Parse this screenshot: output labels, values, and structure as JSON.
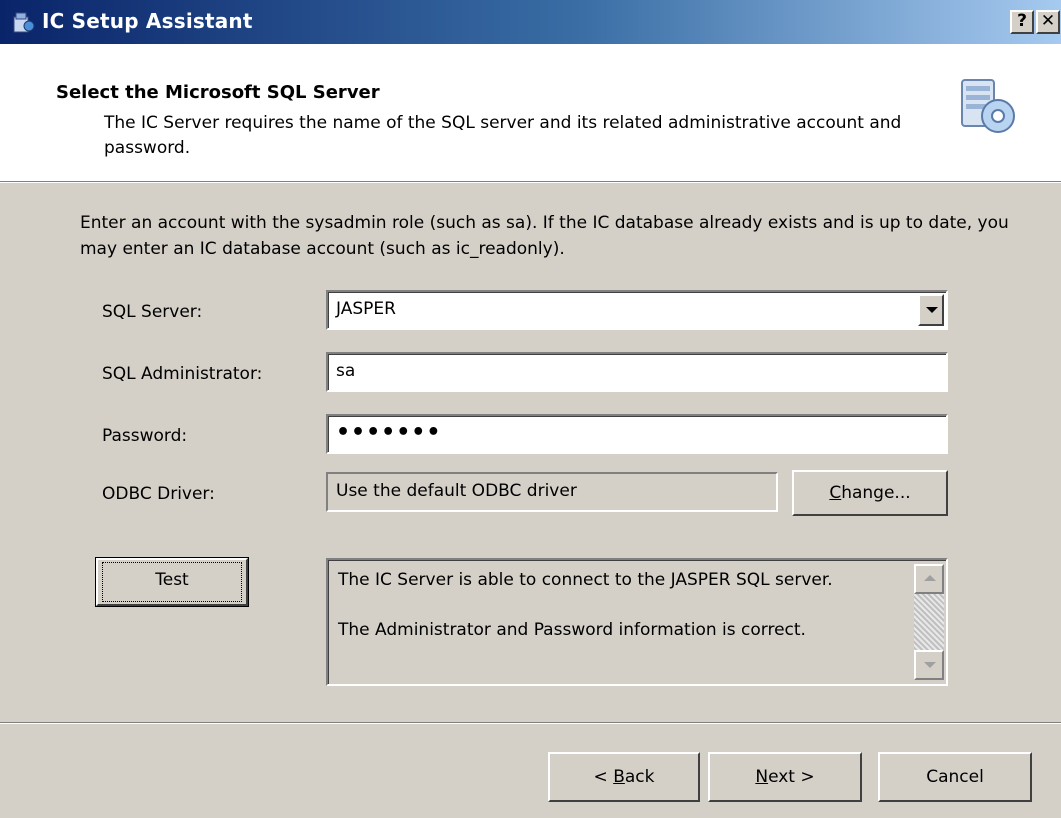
{
  "window": {
    "title": "IC Setup Assistant",
    "help_label": "?",
    "close_label": "✕",
    "icon": "setup-app-icon"
  },
  "header": {
    "title": "Select the Microsoft SQL Server",
    "description": "The IC Server requires the name of the SQL server and its related administrative account and password.",
    "icon": "database-server-icon"
  },
  "instructions": "Enter an account with the sysadmin role (such as sa). If the IC database already exists and is up to date, you may enter an IC database account (such as ic_readonly).",
  "form": {
    "sql_server": {
      "label": "SQL Server:",
      "value": "JASPER"
    },
    "sql_admin": {
      "label": "SQL Administrator:",
      "value": "sa"
    },
    "password": {
      "label": "Password:",
      "value": "•••••••"
    },
    "odbc_driver": {
      "label": "ODBC Driver:",
      "value": "Use the default ODBC driver",
      "change_prefix": "C",
      "change_rest": "hange..."
    }
  },
  "test": {
    "button_label": "Test",
    "result_line1": "The IC Server is able to connect to the JASPER SQL server.",
    "result_line2": "The Administrator and Password information is correct."
  },
  "footer": {
    "back_prefix": "< ",
    "back_key": "B",
    "back_rest": "ack",
    "next_key": "N",
    "next_rest": "ext >",
    "cancel_label": "Cancel"
  },
  "colors": {
    "dialog_bg": "#d4d0c8",
    "title_bar_start": "#0a246a",
    "title_bar_end": "#a6caf0"
  }
}
